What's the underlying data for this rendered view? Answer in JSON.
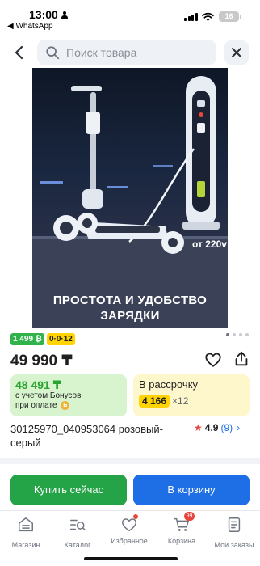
{
  "status_bar": {
    "time": "13:00",
    "back_app": "◀ WhatsApp",
    "battery": "16"
  },
  "search": {
    "placeholder": "Поиск товара"
  },
  "product_image": {
    "promo_text": "ПРОСТОТА И УДОБСТВО ЗАРЯДКИ",
    "voltage_label": "от 220v"
  },
  "badges": {
    "bonus": "1 499 ₿",
    "installment": "0·0·12"
  },
  "price": "49 990 ₸",
  "bonus_card": {
    "price": "48 491 ₸",
    "line1": "с учетом Бонусов",
    "line2": "при оплате",
    "coin": "Б"
  },
  "installment_card": {
    "label": "В рассрочку",
    "amount": "4 166",
    "times": "×12"
  },
  "product": {
    "name": "30125970_040953064 розовый-серый",
    "rating": "4.9",
    "reviews": "(9)"
  },
  "actions": {
    "buy_now": "Купить сейчас",
    "add_to_cart": "В корзину"
  },
  "nav": {
    "shop": "Магазин",
    "catalog": "Каталог",
    "favorites": "Избранное",
    "cart": "Корзина",
    "cart_count": "99",
    "orders": "Мои заказы"
  },
  "colors": {
    "green": "#24a347",
    "blue": "#1e6fe6",
    "yellow": "#ffd400",
    "red": "#e8453c"
  }
}
